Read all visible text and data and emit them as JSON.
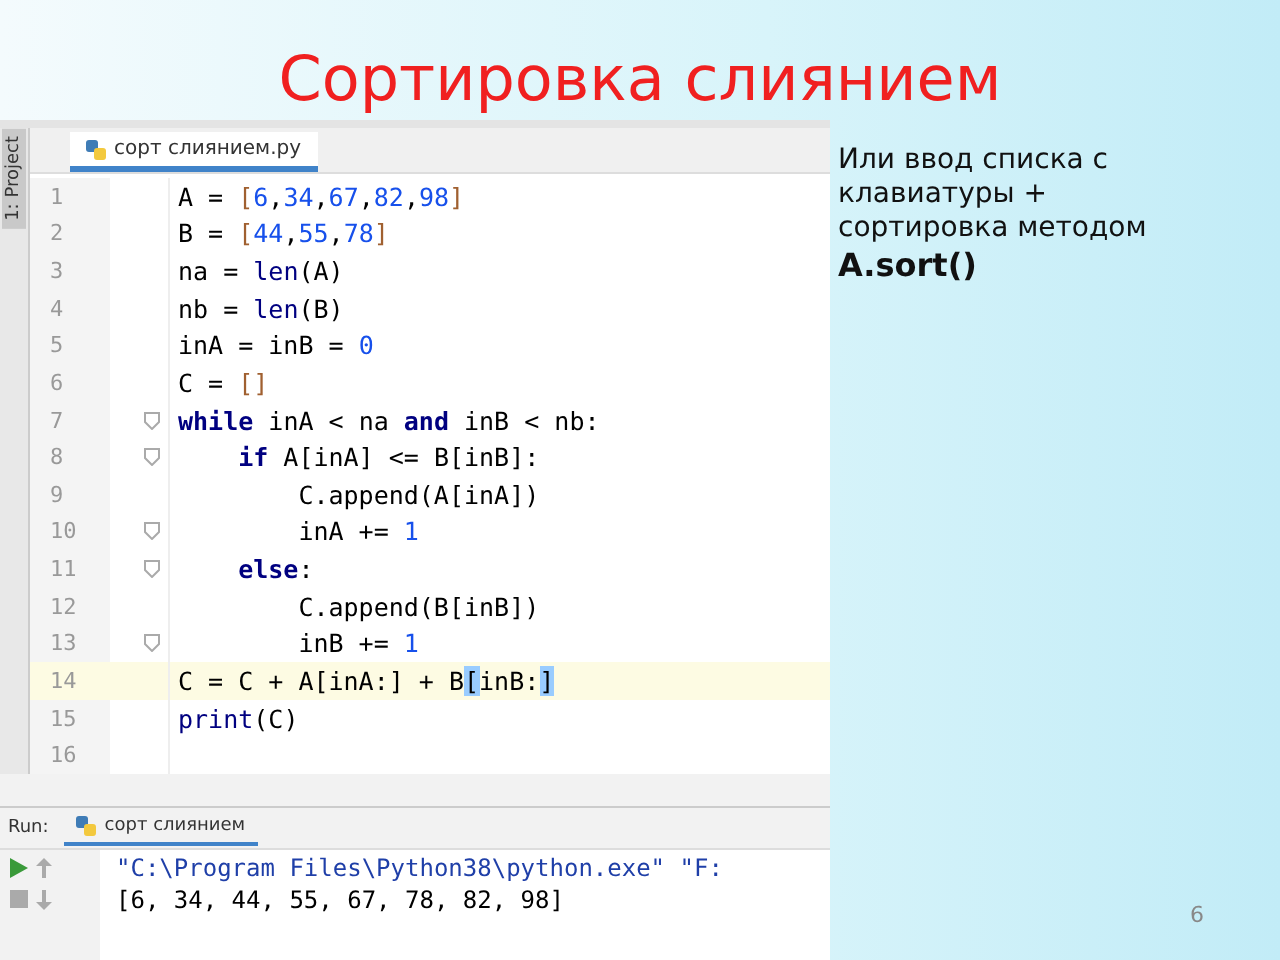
{
  "slide": {
    "title": "Сортировка слиянием",
    "page_number": "6"
  },
  "ide": {
    "side_tab": "1: Project",
    "file_tab": "сорт слиянием.py",
    "lines": [
      {
        "number": "1",
        "fold": false,
        "current": false,
        "tokens": [
          {
            "text": "A = ",
            "kind": "plain"
          },
          {
            "text": "[",
            "kind": "bracket"
          },
          {
            "text": "6",
            "kind": "num"
          },
          {
            "text": ",",
            "kind": "plain"
          },
          {
            "text": "34",
            "kind": "num"
          },
          {
            "text": ",",
            "kind": "plain"
          },
          {
            "text": "67",
            "kind": "num"
          },
          {
            "text": ",",
            "kind": "plain"
          },
          {
            "text": "82",
            "kind": "num"
          },
          {
            "text": ",",
            "kind": "plain"
          },
          {
            "text": "98",
            "kind": "num"
          },
          {
            "text": "]",
            "kind": "bracket"
          }
        ]
      },
      {
        "number": "2",
        "fold": false,
        "current": false,
        "tokens": [
          {
            "text": "B = ",
            "kind": "plain"
          },
          {
            "text": "[",
            "kind": "bracket"
          },
          {
            "text": "44",
            "kind": "num"
          },
          {
            "text": ",",
            "kind": "plain"
          },
          {
            "text": "55",
            "kind": "num"
          },
          {
            "text": ",",
            "kind": "plain"
          },
          {
            "text": "78",
            "kind": "num"
          },
          {
            "text": "]",
            "kind": "bracket"
          }
        ]
      },
      {
        "number": "3",
        "fold": false,
        "current": false,
        "tokens": [
          {
            "text": "na = ",
            "kind": "plain"
          },
          {
            "text": "len",
            "kind": "builtin"
          },
          {
            "text": "(A)",
            "kind": "plain"
          }
        ]
      },
      {
        "number": "4",
        "fold": false,
        "current": false,
        "tokens": [
          {
            "text": "nb = ",
            "kind": "plain"
          },
          {
            "text": "len",
            "kind": "builtin"
          },
          {
            "text": "(B)",
            "kind": "plain"
          }
        ]
      },
      {
        "number": "5",
        "fold": false,
        "current": false,
        "tokens": [
          {
            "text": "inA = inB = ",
            "kind": "plain"
          },
          {
            "text": "0",
            "kind": "num"
          }
        ]
      },
      {
        "number": "6",
        "fold": false,
        "current": false,
        "tokens": [
          {
            "text": "C = ",
            "kind": "plain"
          },
          {
            "text": "[]",
            "kind": "bracket"
          }
        ]
      },
      {
        "number": "7",
        "fold": true,
        "current": false,
        "tokens": [
          {
            "text": "while",
            "kind": "kw"
          },
          {
            "text": " inA < na ",
            "kind": "plain"
          },
          {
            "text": "and",
            "kind": "kw"
          },
          {
            "text": " inB < nb:",
            "kind": "plain"
          }
        ]
      },
      {
        "number": "8",
        "fold": true,
        "current": false,
        "tokens": [
          {
            "text": "    if",
            "kind": "kw"
          },
          {
            "text": " A[inA] <= B[inB]:",
            "kind": "plain"
          }
        ]
      },
      {
        "number": "9",
        "fold": false,
        "current": false,
        "tokens": [
          {
            "text": "        C.append(A[inA])",
            "kind": "plain"
          }
        ]
      },
      {
        "number": "10",
        "fold": true,
        "current": false,
        "tokens": [
          {
            "text": "        inA += ",
            "kind": "plain"
          },
          {
            "text": "1",
            "kind": "num"
          }
        ]
      },
      {
        "number": "11",
        "fold": true,
        "current": false,
        "tokens": [
          {
            "text": "    else",
            "kind": "kw"
          },
          {
            "text": ":",
            "kind": "plain"
          }
        ]
      },
      {
        "number": "12",
        "fold": false,
        "current": false,
        "tokens": [
          {
            "text": "        C.append(B[inB])",
            "kind": "plain"
          }
        ]
      },
      {
        "number": "13",
        "fold": true,
        "current": false,
        "tokens": [
          {
            "text": "        inB += ",
            "kind": "plain"
          },
          {
            "text": "1",
            "kind": "num"
          }
        ]
      },
      {
        "number": "14",
        "fold": false,
        "current": true,
        "tokens": [
          {
            "text": "C = C + A[inA:] + B",
            "kind": "plain"
          },
          {
            "text": "[",
            "kind": "match"
          },
          {
            "text": "inB:",
            "kind": "plain"
          },
          {
            "text": "]",
            "kind": "match"
          }
        ]
      },
      {
        "number": "15",
        "fold": false,
        "current": false,
        "tokens": [
          {
            "text": "print",
            "kind": "builtin"
          },
          {
            "text": "(C)",
            "kind": "plain"
          }
        ]
      },
      {
        "number": "16",
        "fold": false,
        "current": false
      }
    ],
    "run": {
      "label": "Run:",
      "tab": "сорт слиянием",
      "output": [
        "\"C:\\Program Files\\Python38\\python.exe\" \"F:",
        "[6, 34, 44, 55, 67, 78, 82, 98]"
      ]
    }
  },
  "note": {
    "text": "Или ввод списка с клавиатуры + сортировка методом",
    "code": "A.sort()"
  }
}
